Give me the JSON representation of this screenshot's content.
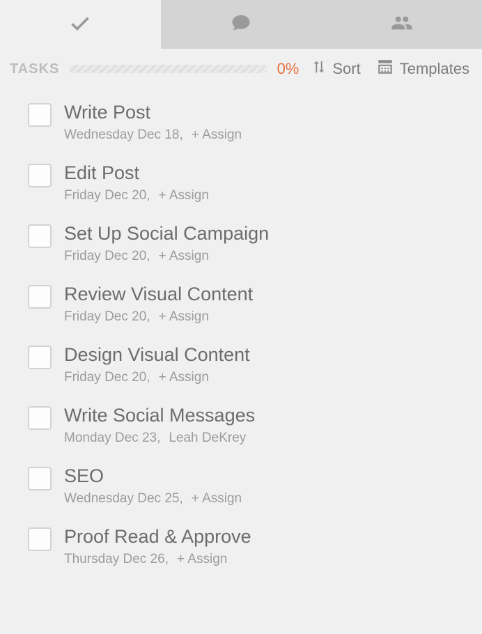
{
  "header": {
    "tasks_label": "TASKS",
    "progress_pct": "0%",
    "sort_label": "Sort",
    "templates_label": "Templates"
  },
  "tasks": [
    {
      "title": "Write Post",
      "date": "Wednesday Dec 18",
      "assignee": "+ Assign",
      "assign_interactable": true
    },
    {
      "title": "Edit Post",
      "date": "Friday Dec 20",
      "assignee": "+ Assign",
      "assign_interactable": true
    },
    {
      "title": "Set Up Social Campaign",
      "date": "Friday Dec 20",
      "assignee": "+ Assign",
      "assign_interactable": true
    },
    {
      "title": "Review Visual Content",
      "date": "Friday Dec 20",
      "assignee": "+ Assign",
      "assign_interactable": true
    },
    {
      "title": "Design Visual Content",
      "date": "Friday Dec 20",
      "assignee": "+ Assign",
      "assign_interactable": true
    },
    {
      "title": "Write Social Messages",
      "date": "Monday Dec 23",
      "assignee": "Leah DeKrey",
      "assign_interactable": true
    },
    {
      "title": "SEO",
      "date": "Wednesday Dec 25",
      "assignee": "+ Assign",
      "assign_interactable": true
    },
    {
      "title": "Proof Read & Approve",
      "date": "Thursday Dec 26",
      "assignee": "+ Assign",
      "assign_interactable": true
    }
  ]
}
